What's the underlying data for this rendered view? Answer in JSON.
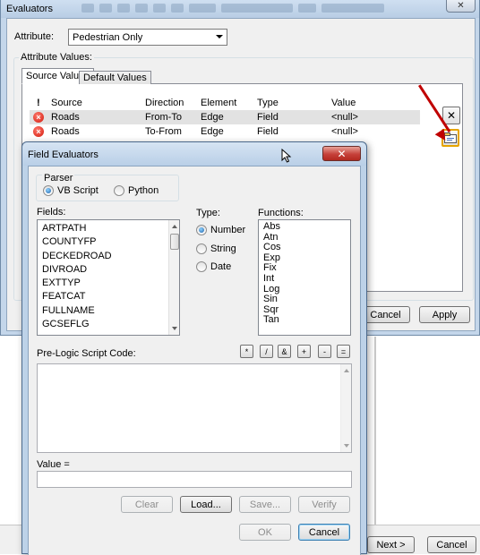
{
  "evaluators": {
    "title": "Evaluators",
    "close_glyph": "✕",
    "attribute_label": "Attribute:",
    "attribute_value": "Pedestrian Only",
    "attribute_values_label": "Attribute Values:",
    "tabs": [
      {
        "label": "Source Values",
        "active": true
      },
      {
        "label": "Default Values",
        "active": false
      }
    ],
    "columns": [
      "!",
      "Source",
      "Direction",
      "Element",
      "Type",
      "Value"
    ],
    "rows": [
      {
        "source": "Roads",
        "direction": "From-To",
        "element": "Edge",
        "type": "Field",
        "value": "<null>"
      },
      {
        "source": "Roads",
        "direction": "To-From",
        "element": "Edge",
        "type": "Field",
        "value": "<null>"
      }
    ],
    "remove_glyph": "✕",
    "cancel_label": "Cancel",
    "apply_label": "Apply"
  },
  "wizard": {
    "next_label": "Next >",
    "cancel_label": "Cancel"
  },
  "field_evaluators": {
    "title": "Field Evaluators",
    "close_glyph": "✕",
    "parser_label": "Parser",
    "parser_options": [
      {
        "label": "VB Script",
        "selected": true
      },
      {
        "label": "Python",
        "selected": false
      }
    ],
    "fields_label": "Fields:",
    "fields": [
      "ARTPATH",
      "COUNTYFP",
      "DECKEDROAD",
      "DIVROAD",
      "EXTTYP",
      "FEATCAT",
      "FULLNAME",
      "GCSEFLG"
    ],
    "type_label": "Type:",
    "type_options": [
      {
        "label": "Number",
        "selected": true
      },
      {
        "label": "String",
        "selected": false
      },
      {
        "label": "Date",
        "selected": false
      }
    ],
    "functions_label": "Functions:",
    "functions": [
      "Abs",
      "Atn",
      "Cos",
      "Exp",
      "Fix",
      "Int",
      "Log",
      "Sin",
      "Sqr",
      "Tan"
    ],
    "prelogic_label": "Pre-Logic Script Code:",
    "operators": [
      "*",
      "/",
      "&",
      "+",
      "-",
      "="
    ],
    "value_label": "Value =",
    "clear_label": "Clear",
    "load_label": "Load...",
    "save_label": "Save...",
    "verify_label": "Verify",
    "ok_label": "OK",
    "cancel_label": "Cancel"
  },
  "colors": {
    "window_frame": "#c4d6ea",
    "dialog_frame": "#bdd2e8",
    "error_icon": "#d2180b",
    "annotation_arrow": "#c00000"
  }
}
